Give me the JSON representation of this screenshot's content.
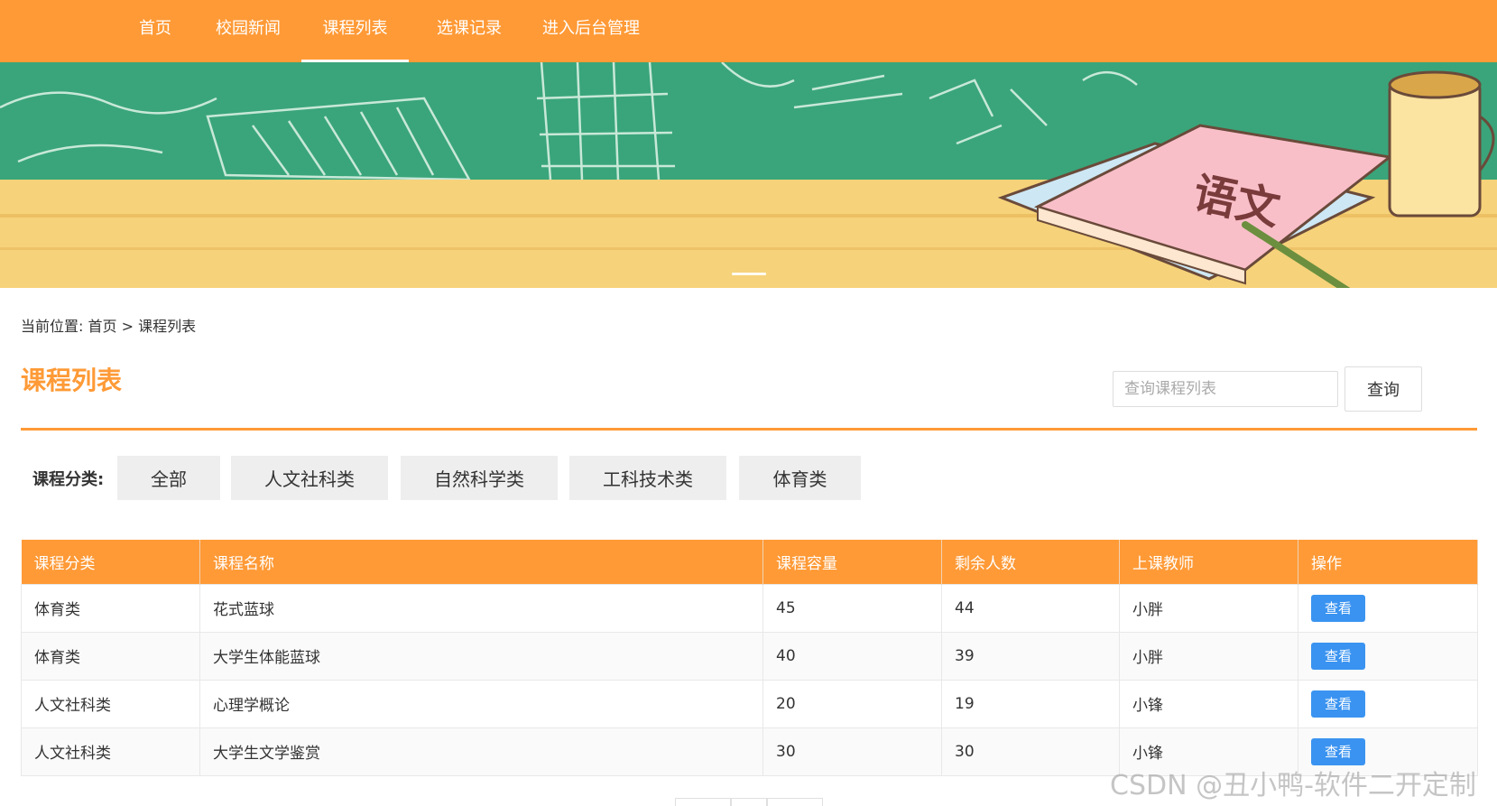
{
  "nav": {
    "items": [
      {
        "label": "首页"
      },
      {
        "label": "校园新闻"
      },
      {
        "label": "课程列表",
        "active": true
      },
      {
        "label": "选课记录"
      },
      {
        "label": "进入后台管理"
      }
    ]
  },
  "banner": {
    "book_title": "语文"
  },
  "breadcrumb": {
    "prefix": "当前位置:",
    "home": "首页",
    "separator": ">",
    "current": "课程列表"
  },
  "page": {
    "title": "课程列表"
  },
  "search": {
    "placeholder": "查询课程列表",
    "button_label": "查询"
  },
  "categories": {
    "label": "课程分类:",
    "items": [
      "全部",
      "人文社科类",
      "自然科学类",
      "工科技术类",
      "体育类"
    ]
  },
  "table": {
    "headers": [
      "课程分类",
      "课程名称",
      "课程容量",
      "剩余人数",
      "上课教师",
      "操作"
    ],
    "rows": [
      [
        "体育类",
        "花式蓝球",
        "45",
        "44",
        "小胖",
        "查看"
      ],
      [
        "体育类",
        "大学生体能蓝球",
        "40",
        "39",
        "小胖",
        "查看"
      ],
      [
        "人文社科类",
        "心理学概论",
        "20",
        "19",
        "小锋",
        "查看"
      ],
      [
        "人文社科类",
        "大学生文学鉴赏",
        "30",
        "30",
        "小锋",
        "查看"
      ]
    ]
  },
  "watermark": "CSDN @丑小鸭-软件二开定制",
  "colors": {
    "primary": "#ff9a36",
    "view_button": "#3a93f0",
    "chalkboard": "#3aa57a",
    "desk": "#f6d27a"
  }
}
